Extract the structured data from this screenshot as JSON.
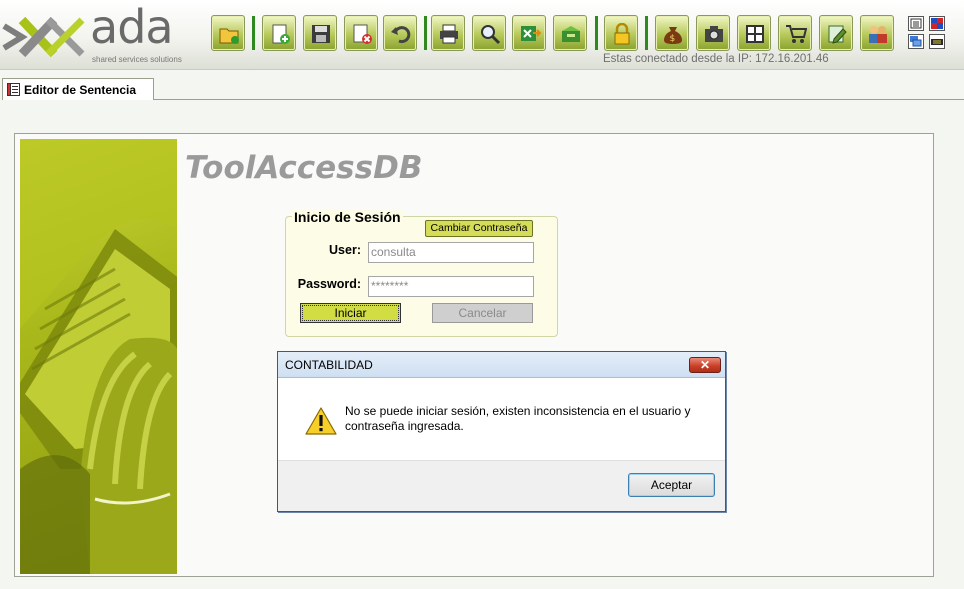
{
  "header": {
    "logo_text": "ada",
    "logo_tagline": "shared services solutions",
    "ip_label": "Estas conectado desde la IP: 172.16.201.46"
  },
  "toolbar": {
    "buttons": [
      {
        "name": "open-folder-button",
        "icon": "folder-icon"
      },
      {
        "name": "new-button",
        "icon": "new-document-icon"
      },
      {
        "name": "save-button",
        "icon": "floppy-disk-icon"
      },
      {
        "name": "delete-button",
        "icon": "delete-icon"
      },
      {
        "name": "undo-button",
        "icon": "undo-icon"
      },
      {
        "name": "print-button",
        "icon": "printer-icon"
      },
      {
        "name": "search-button",
        "icon": "magnifier-icon"
      },
      {
        "name": "export-button",
        "icon": "export-icon"
      },
      {
        "name": "inbox-button",
        "icon": "inbox-icon"
      },
      {
        "name": "lock-button",
        "icon": "padlock-icon"
      },
      {
        "name": "money-button",
        "icon": "money-bag-icon"
      },
      {
        "name": "camera-button",
        "icon": "camera-icon"
      },
      {
        "name": "grid-button",
        "icon": "grid-icon"
      },
      {
        "name": "cart-button",
        "icon": "cart-icon"
      },
      {
        "name": "edit-button",
        "icon": "edit-icon"
      },
      {
        "name": "users-button",
        "icon": "users-icon"
      }
    ]
  },
  "tab": {
    "label": "Editor de Sentencia"
  },
  "main": {
    "app_title": "ToolAccessDB"
  },
  "login": {
    "legend": "Inicio de Sesión",
    "change_password_label": "Cambiar Contraseña",
    "user_label": "User:",
    "user_value": "consulta",
    "password_label": "Password:",
    "password_value": "********",
    "login_button": "Iniciar",
    "cancel_button": "Cancelar"
  },
  "dialog": {
    "title": "CONTABILIDAD",
    "close_glyph": "✕",
    "message": "No se puede iniciar sesión, existen inconsistencia en el usuario y contraseña ingresada.",
    "ok_button": "Aceptar"
  },
  "colors": {
    "accent": "#b7c95a",
    "separator": "#2f8a1e",
    "dialog_border": "#3a5a86"
  }
}
